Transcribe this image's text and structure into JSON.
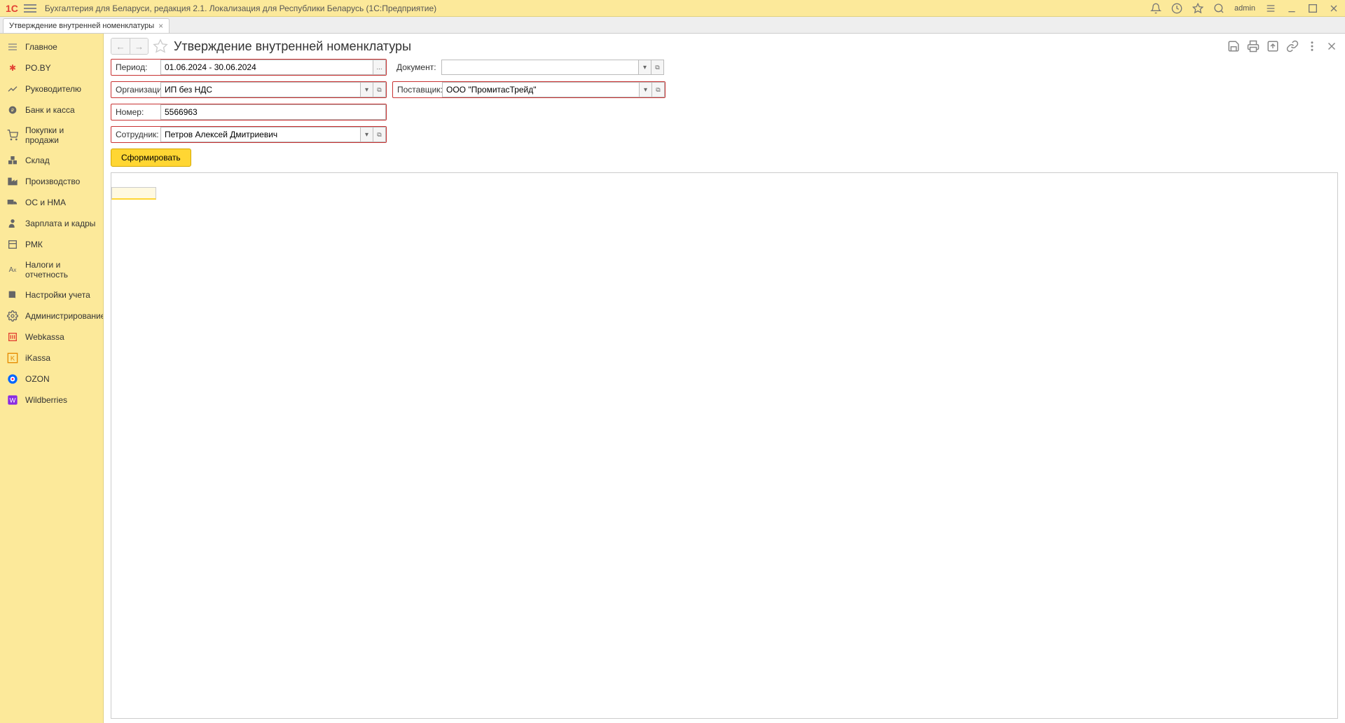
{
  "header": {
    "title": "Бухгалтерия для Беларуси, редакция 2.1. Локализация для Республики Беларусь   (1С:Предприятие)",
    "user": "admin"
  },
  "tab": {
    "label": "Утверждение внутренней номенклатуры"
  },
  "sidebar": {
    "items": [
      {
        "label": "Главное"
      },
      {
        "label": "PO.BY"
      },
      {
        "label": "Руководителю"
      },
      {
        "label": "Банк и касса"
      },
      {
        "label": "Покупки и продажи"
      },
      {
        "label": "Склад"
      },
      {
        "label": "Производство"
      },
      {
        "label": "ОС и НМА"
      },
      {
        "label": "Зарплата и кадры"
      },
      {
        "label": "РМК"
      },
      {
        "label": "Налоги и отчетность"
      },
      {
        "label": "Настройки учета"
      },
      {
        "label": "Администрирование"
      },
      {
        "label": "Webkassa"
      },
      {
        "label": "iKassa"
      },
      {
        "label": "OZON"
      },
      {
        "label": "Wildberries"
      }
    ]
  },
  "page": {
    "title": "Утверждение внутренней номенклатуры"
  },
  "form": {
    "period_label": "Период:",
    "period_value": "01.06.2024 - 30.06.2024",
    "document_label": "Документ:",
    "document_value": "",
    "organization_label": "Организация:",
    "organization_value": "ИП без НДС",
    "supplier_label": "Поставщик:",
    "supplier_value": "ООО \"ПромитасТрейд\"",
    "number_label": "Номер:",
    "number_value": "5566963",
    "employee_label": "Сотрудник:",
    "employee_value": "Петров Алексей Дмитриевич",
    "generate_button": "Сформировать"
  }
}
